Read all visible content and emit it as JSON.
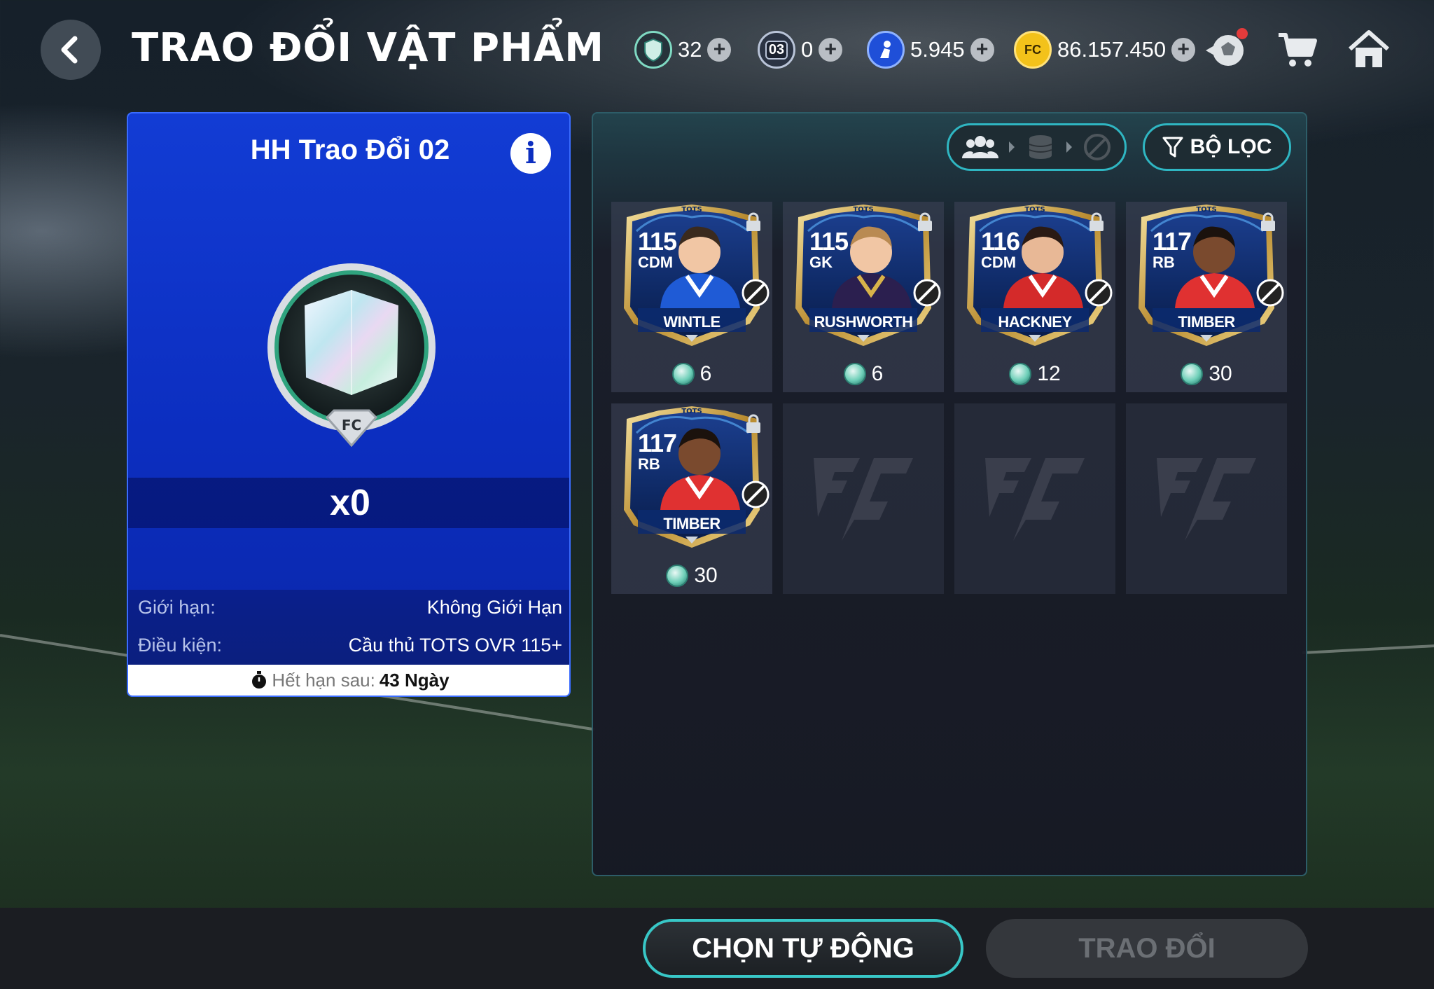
{
  "header": {
    "title": "TRAO ĐỔI VẬT PHẨM",
    "currencies": [
      {
        "name": "exchange-tokens",
        "value": "32",
        "color": "#7fd9c2"
      },
      {
        "name": "bp-tickets",
        "value": "0",
        "badge": "03",
        "color": "#b9c4d8"
      },
      {
        "name": "fc-points",
        "value": "5.945",
        "color": "#3a7cff"
      },
      {
        "name": "bp-coins",
        "value": "86.157.450",
        "color": "#f3c21a"
      }
    ]
  },
  "left_panel": {
    "title": "HH Trao Đổi 02",
    "count": "x0",
    "limit_label": "Giới hạn:",
    "limit_value": "Không Giới Hạn",
    "condition_label": "Điều kiện:",
    "condition_value": "Cầu thủ TOTS OVR 115+",
    "expiry_label": "Hết hạn sau:",
    "expiry_value": "43 Ngày"
  },
  "right_panel": {
    "filter_label": "BỘ LỌC",
    "cards": [
      {
        "ovr": "115",
        "pos": "CDM",
        "name": "WINTLE",
        "cost": "6",
        "kit": "#1f5bd6",
        "kit2": "#ffffff",
        "skin": "#f1c6a4",
        "hair": "#3a2a1e"
      },
      {
        "ovr": "115",
        "pos": "GK",
        "name": "RUSHWORTH",
        "cost": "6",
        "kit": "#2b1f4f",
        "kit2": "#d8b34a",
        "skin": "#f1c6a4",
        "hair": "#b98a52"
      },
      {
        "ovr": "116",
        "pos": "CDM",
        "name": "HACKNEY",
        "cost": "12",
        "kit": "#d42a2a",
        "kit2": "#ffffff",
        "skin": "#e8b896",
        "hair": "#2a1a14"
      },
      {
        "ovr": "117",
        "pos": "RB",
        "name": "TIMBER",
        "cost": "30",
        "kit": "#e03131",
        "kit2": "#ffffff",
        "skin": "#7a4a2e",
        "hair": "#1b120d"
      },
      {
        "ovr": "117",
        "pos": "RB",
        "name": "TIMBER",
        "cost": "30",
        "kit": "#e03131",
        "kit2": "#ffffff",
        "skin": "#7a4a2e",
        "hair": "#1b120d"
      }
    ]
  },
  "footer": {
    "auto_select": "CHỌN TỰ ĐỘNG",
    "trade": "TRAO ĐỔI"
  }
}
